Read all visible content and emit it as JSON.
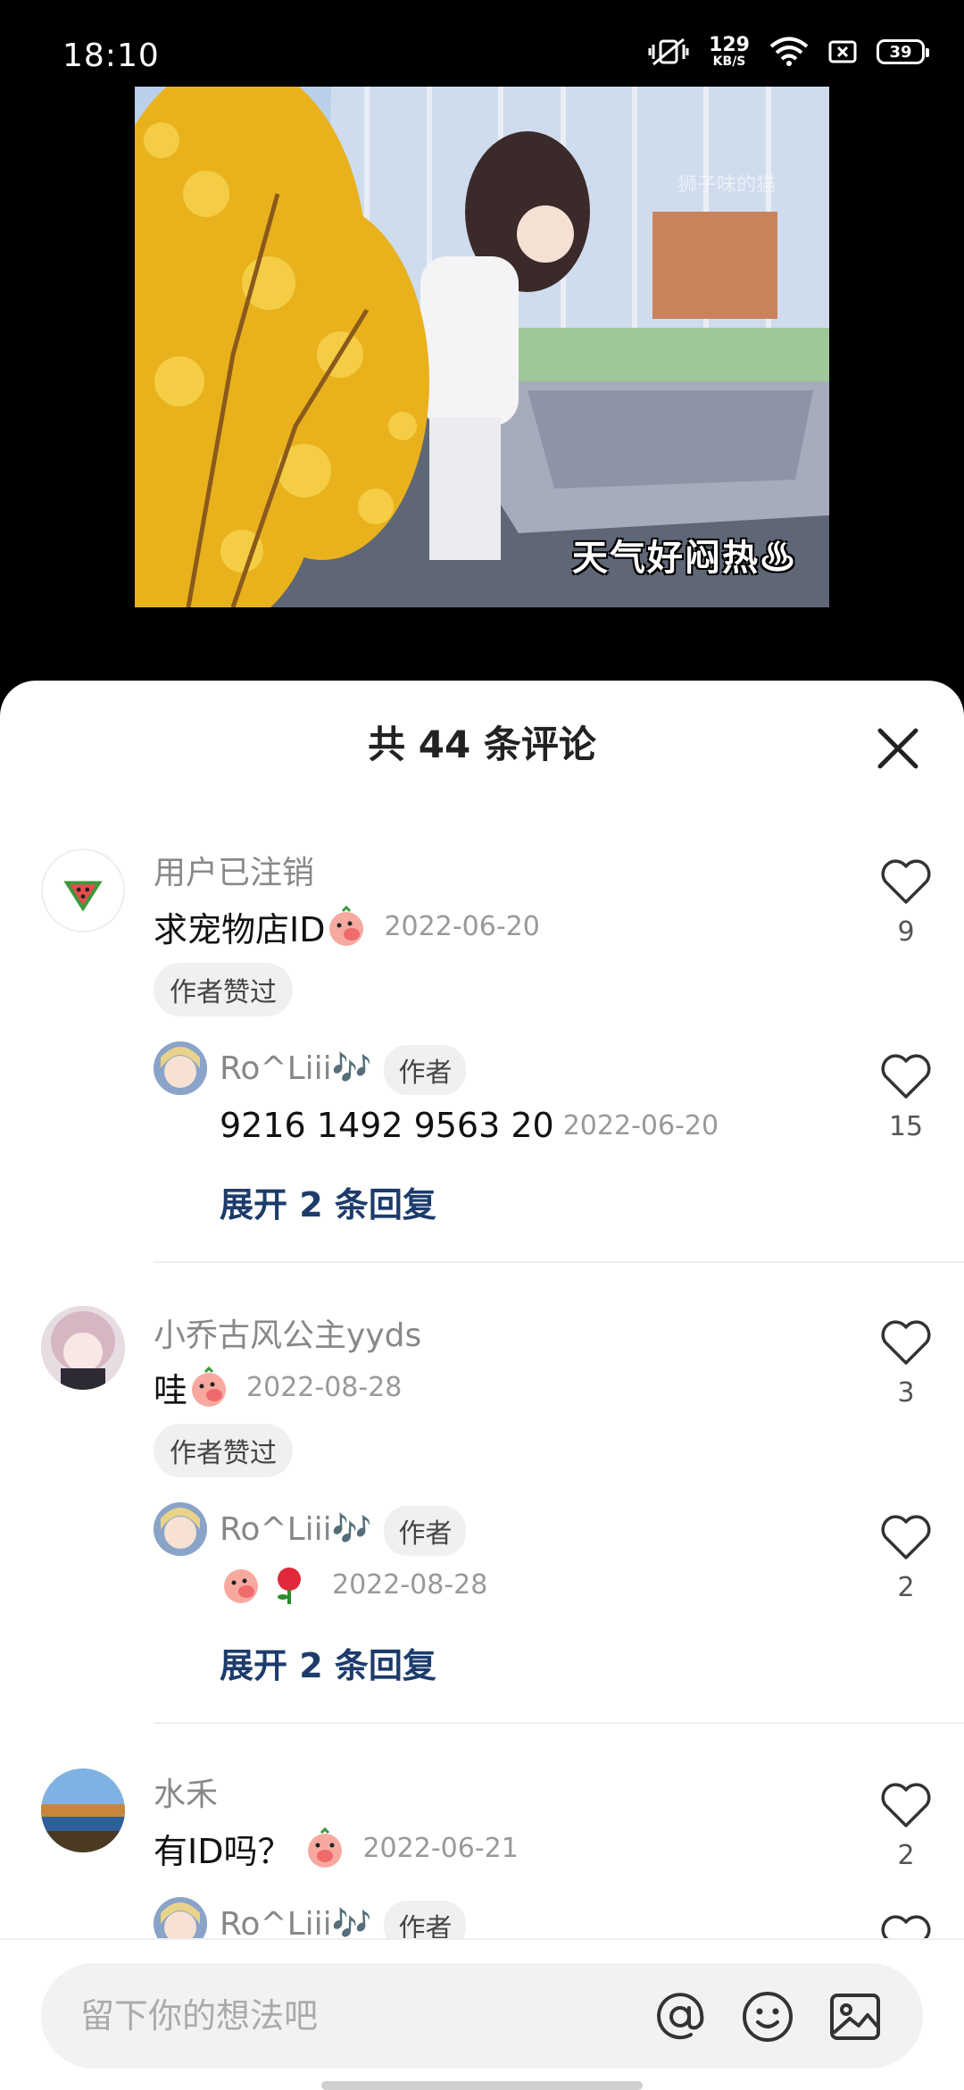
{
  "status_bar": {
    "time": "18:10",
    "net_speed": "129",
    "net_unit": "KB/S",
    "battery": "39"
  },
  "video": {
    "watermark": "狮子味的猫",
    "caption": "天气好闷热♨"
  },
  "sheet": {
    "title": "共 44 条评论"
  },
  "comments": [
    {
      "name": "用户已注销",
      "text": "求宠物店ID",
      "date": "2022-06-20",
      "badge": "作者赞过",
      "likes": "9",
      "reply": {
        "name": "Ro^Liii🎶",
        "author_badge": "作者",
        "text": "9216 1492 9563 20",
        "date": "2022-06-20",
        "likes": "15"
      },
      "expand": "展开 2 条回复"
    },
    {
      "name": "小乔古风公主yyds",
      "text": "哇",
      "date": "2022-08-28",
      "badge": "作者赞过",
      "likes": "3",
      "reply": {
        "name": "Ro^Liii🎶",
        "author_badge": "作者",
        "text": "",
        "date": "2022-08-28",
        "likes": "2"
      },
      "expand": "展开 2 条回复"
    },
    {
      "name": "水禾",
      "text": "有ID吗？",
      "date": "2022-06-21",
      "likes": "2",
      "reply": {
        "name": "Ro^Liii🎶",
        "author_badge": "作者"
      }
    }
  ],
  "input": {
    "placeholder": "留下你的想法吧"
  },
  "colors": {
    "expand_link": "#1d3c6b",
    "sheet_bg": "#ffffff",
    "input_bg": "#f2f2f2"
  }
}
